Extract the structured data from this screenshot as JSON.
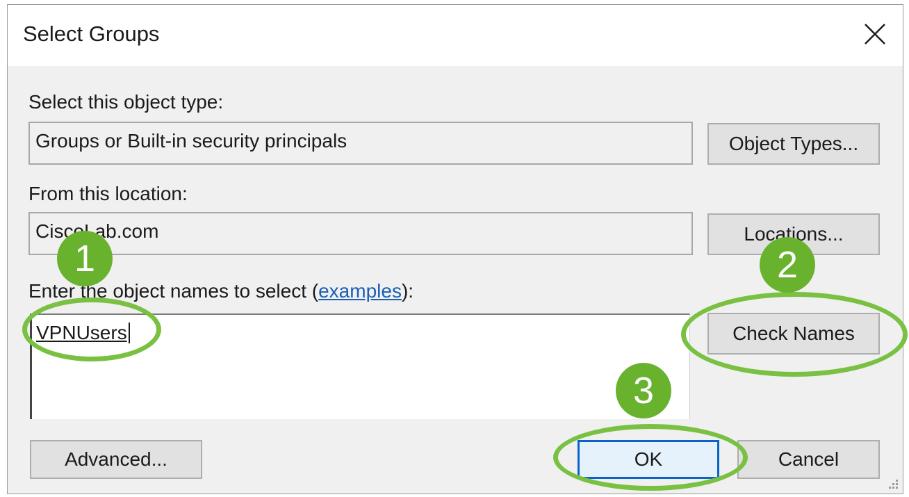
{
  "dialog": {
    "title": "Select Groups",
    "close_icon": "close-icon"
  },
  "object_type": {
    "label": "Select this object type:",
    "value": "Groups or Built-in security principals",
    "button_label": "Object Types..."
  },
  "location": {
    "label": "From this location:",
    "value": "CiscoLab.com",
    "button_label": "Locations..."
  },
  "object_names": {
    "label_prefix": "Enter the object names to select (",
    "label_link": "examples",
    "label_suffix": "):",
    "value": "VPNUsers",
    "check_names_label": "Check Names"
  },
  "footer": {
    "advanced_label": "Advanced...",
    "ok_label": "OK",
    "cancel_label": "Cancel"
  },
  "annotations": {
    "step1": "1",
    "step2": "2",
    "step3": "3",
    "accent_color": "#7ac143",
    "badge_color": "#68b22e"
  }
}
